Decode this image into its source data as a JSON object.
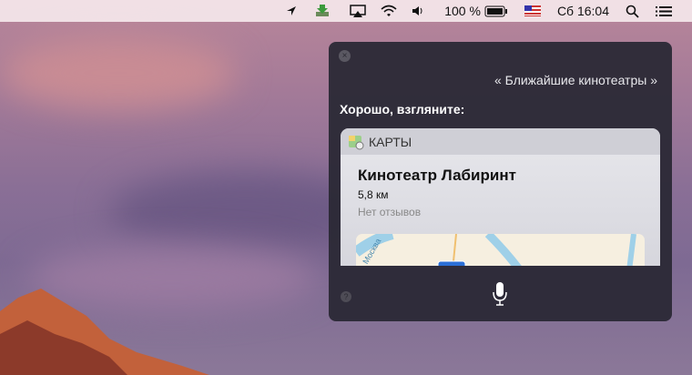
{
  "menubar": {
    "battery": "100 %",
    "clock": "Сб 16:04"
  },
  "siri": {
    "query": "« Ближайшие кинотеатры »",
    "answer": "Хорошо, взгляните:",
    "card": {
      "app": "КАРТЫ",
      "place": "Кинотеатр Лабиринт",
      "distance": "5,8 км",
      "reviews": "Нет отзывов",
      "map_label": "Москва"
    },
    "close_symbol": "×",
    "help_symbol": "?"
  }
}
